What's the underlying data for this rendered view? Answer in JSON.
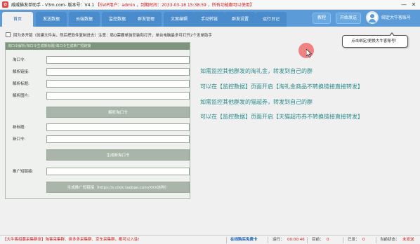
{
  "window": {
    "app_icon": "app-logo-icon",
    "title_prefix": "威威猫发单助手 - V3m.com- 版本号：V4.1",
    "title_highlight": "【SVIP用户：admin ，到期时间：2033-03-18 15:38:59 ，所有功能都可以使用】",
    "minimize_glyph": "—",
    "close_glyph": "✕"
  },
  "tabs": [
    {
      "label": "首页",
      "active": true
    },
    {
      "label": "发送数据",
      "active": false
    },
    {
      "label": "云端数据",
      "active": false
    },
    {
      "label": "监控数据",
      "active": false
    },
    {
      "label": "群发管理",
      "active": false
    },
    {
      "label": "文案编辑",
      "active": false
    },
    {
      "label": "手动转链",
      "active": false
    },
    {
      "label": "群发设置",
      "active": false
    },
    {
      "label": "运行日记",
      "active": false
    }
  ],
  "toolbar": {
    "tutorial_label": "教程",
    "start_send_label": "开始发送",
    "account_label": "绑定大牛客账号"
  },
  "options": {
    "text": "回为多开版（创建文件夹，然后把软件复制进去）注意：局Q需要单独安装和打开，单台电脑最多可打开2个发单助手"
  },
  "panel": {
    "header": "淘口令解析/淘口令生成新标题/淘口令生成推广短链接",
    "tkl_label": "淘口令:",
    "parse_link_label": "解析链接:",
    "parse_title_label": "解析标题:",
    "parse_image_label": "解析图片:",
    "parse_button": "解析淘口令",
    "new_title_label": "新标题:",
    "new_tkl_label": "新口令:",
    "generate_button": "生成新淘口令",
    "promo_link_label": "推广短链接:",
    "promo_button": "生成推广短链接（https://s.click.taobao.com/XXX这种）"
  },
  "info_lines": [
    "如需监控其他群发的淘礼金，转发到自己的群",
    "可以在【监控数据】页面开启【淘礼金商品不转换链接直接转发】",
    "如需监控其他群发的猫超券，转发到自己的群",
    "可以在【监控数据】页面开启【天猫超市券不转换链接直接转发】"
  ],
  "tooltip": {
    "text": "点击绑定/更换大牛客账号！"
  },
  "status": {
    "notice": "【大牛客招募采集群发】淘客采集群、拼多多采集群、京东采集群，都可以入驻!",
    "buy_link": "在线购买免费卡",
    "run_label": "运行：",
    "run_time": "00:00:46",
    "group_label": "目前：",
    "group_value": "0",
    "sent_label": "已发：",
    "sent_value": "0",
    "status_label": "当前状态：",
    "status_value": "未发送"
  },
  "colors": {
    "accent": "#5a9bd8",
    "panel_header": "#7c957c",
    "info_text": "#2a8a8a",
    "highlight": "#d01818"
  }
}
